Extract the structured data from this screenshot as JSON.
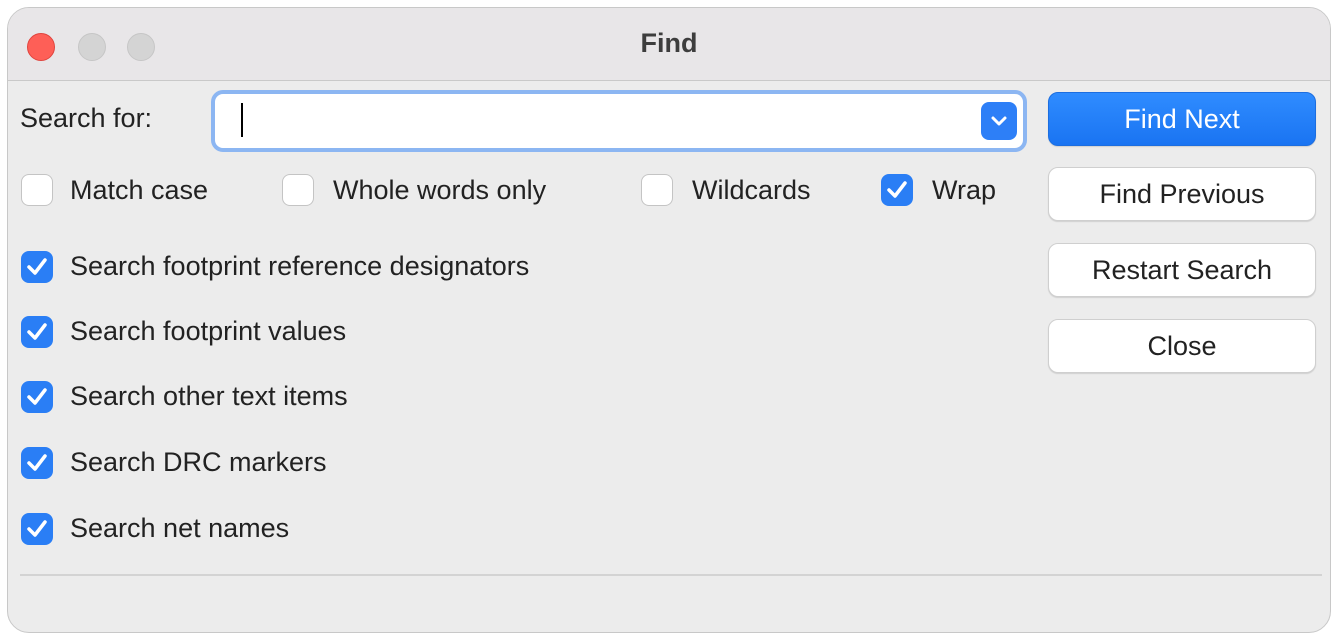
{
  "window": {
    "title": "Find"
  },
  "search": {
    "label": "Search for:",
    "value": "",
    "placeholder": ""
  },
  "buttons": {
    "find_next": "Find Next",
    "find_previous": "Find Previous",
    "restart_search": "Restart Search",
    "close": "Close"
  },
  "options_row": [
    {
      "label": "Match case",
      "checked": false
    },
    {
      "label": "Whole words only",
      "checked": false
    },
    {
      "label": "Wildcards",
      "checked": false
    },
    {
      "label": "Wrap",
      "checked": true
    }
  ],
  "search_options": [
    {
      "label": "Search footprint reference designators",
      "checked": true
    },
    {
      "label": "Search footprint values",
      "checked": true
    },
    {
      "label": "Search other text items",
      "checked": true
    },
    {
      "label": "Search DRC markers",
      "checked": true
    },
    {
      "label": "Search net names",
      "checked": true
    }
  ],
  "colors": {
    "accent": "#2a7ef5",
    "close_light": "#fe5f57",
    "inactive_light": "#d4d4d4"
  }
}
